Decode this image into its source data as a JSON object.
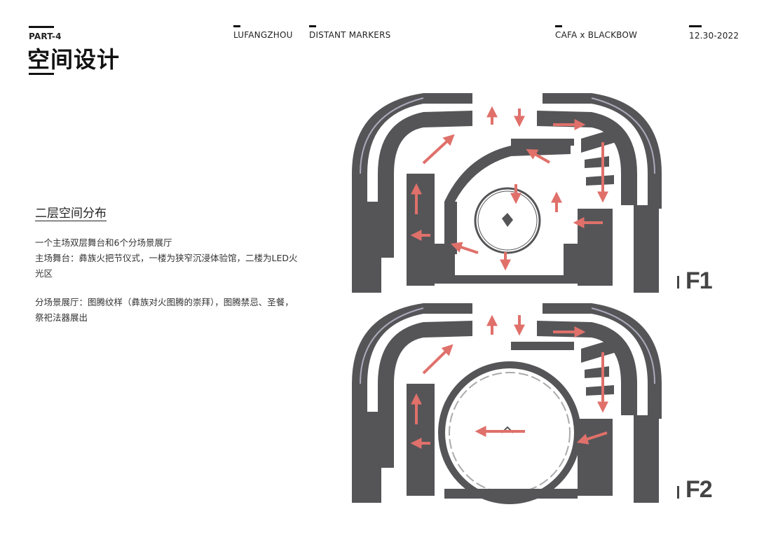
{
  "header": {
    "part": "PART-4",
    "title": "空间设计",
    "project": "LUFANGZHOU",
    "subtitle": "DISTANT MARKERS",
    "collab": "CAFA x BLACKBOW",
    "date": "12.30-2022"
  },
  "content": {
    "heading": "二层空间分布",
    "line1": "一个主场双层舞台和6个分场景展厅",
    "line2": "主场舞台：彝族火把节仪式，一楼为狭窄沉浸体验馆，二楼为LED火光区",
    "line3": "分场景展厅：图腾纹样（彝族对火图腾的崇拜），图腾禁忌、圣餐，祭祀法器展出"
  },
  "plans": {
    "floor1_label": "F1",
    "floor2_label": "F2",
    "wall_color": "#555558",
    "arrow_color": "#e0706a"
  }
}
